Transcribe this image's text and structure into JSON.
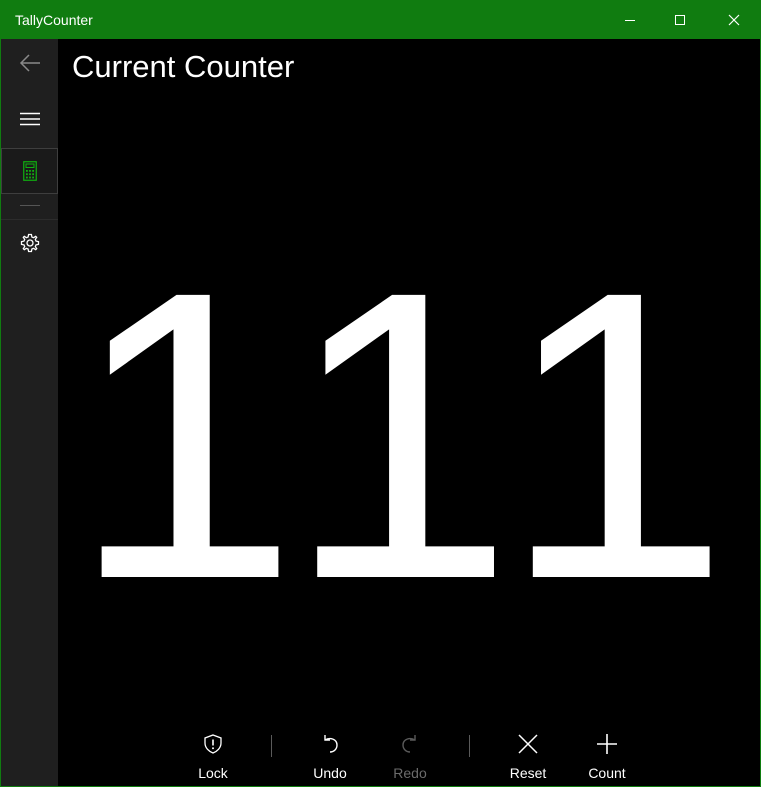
{
  "window": {
    "title": "TallyCounter",
    "accent": "#107c10",
    "controls": [
      "minimize-icon",
      "maximize-icon",
      "close-icon"
    ]
  },
  "sidebar": {
    "items": [
      {
        "name": "back",
        "icon": "arrow-left-icon"
      },
      {
        "name": "menu",
        "icon": "hamburger-icon"
      },
      {
        "name": "counter",
        "icon": "calculator-icon",
        "selected": true
      },
      {
        "name": "settings",
        "icon": "gear-icon"
      }
    ]
  },
  "main": {
    "title": "Current Counter",
    "counter_value": "111"
  },
  "commands": {
    "lock": "Lock",
    "undo": "Undo",
    "redo": "Redo",
    "reset": "Reset",
    "count": "Count",
    "redo_disabled": true
  }
}
